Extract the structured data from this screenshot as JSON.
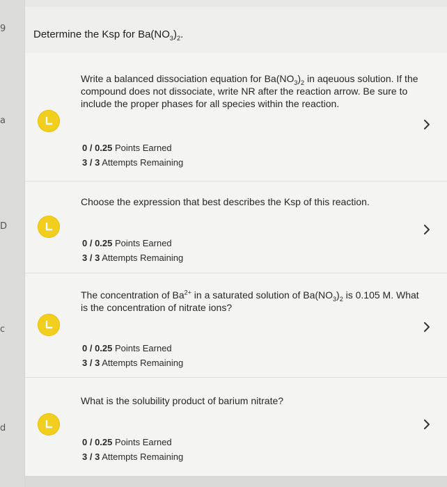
{
  "header": {
    "title_pre": "Determine the Ksp for Ba(NO",
    "title_sub1": "3",
    "title_mid": ")",
    "title_sub2": "2",
    "title_end": "."
  },
  "left_rail_glyphs": [
    "9",
    "a",
    "D",
    "c",
    "d"
  ],
  "steps": [
    {
      "prompt_parts": {
        "p1": "Write a balanced dissociation equation for Ba(NO",
        "s1": "3",
        "p2": ")",
        "s2": "2",
        "p3": " in aqeuous solution. If the compound does not dissociate, write NR after the reaction arrow. Be sure to include the proper phases for all species within the reaction."
      },
      "points": "0 / 0.25",
      "points_label": " Points Earned",
      "attempts": "3 / 3",
      "attempts_label": " Attempts Remaining"
    },
    {
      "prompt": "Choose the expression that best describes the Ksp of this reaction.",
      "points": "0 / 0.25",
      "points_label": " Points Earned",
      "attempts": "3 / 3",
      "attempts_label": " Attempts Remaining"
    },
    {
      "prompt_parts": {
        "p1": "The concentration of Ba",
        "sup1": "2+",
        "p2": " in a saturated solution of Ba(NO",
        "s1": "3",
        "p3": ")",
        "s2": "2",
        "p4": " is 0.105 M. What is the concentration of nitrate ions?"
      },
      "points": "0 / 0.25",
      "points_label": " Points Earned",
      "attempts": "3 / 3",
      "attempts_label": " Attempts Remaining"
    },
    {
      "prompt": "What is the solubility product of barium nitrate?",
      "points": "0 / 0.25",
      "points_label": " Points Earned",
      "attempts": "3 / 3",
      "attempts_label": " Attempts Remaining"
    }
  ],
  "colors": {
    "badge": "#f2cf1e",
    "background": "#f4f4f2",
    "text": "#262626"
  },
  "icons": {
    "badge": "l-shaped-flag-icon",
    "expand": "chevron-right-icon"
  }
}
